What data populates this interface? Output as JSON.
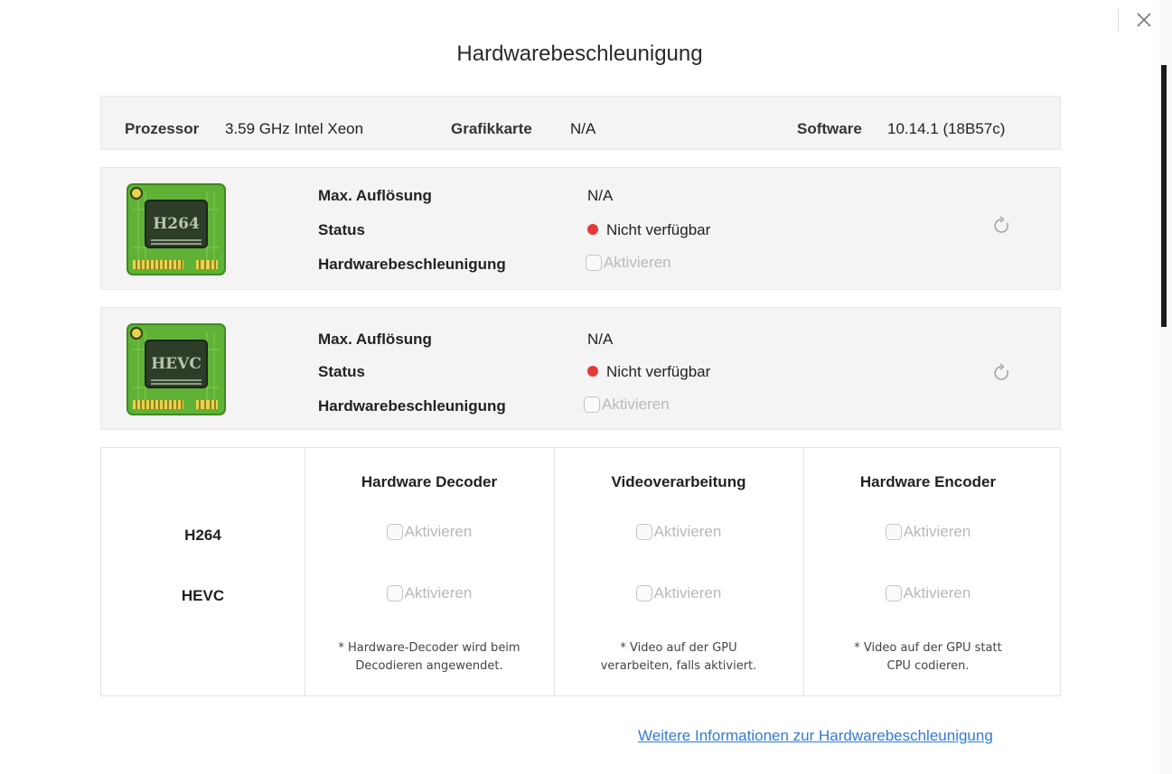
{
  "dialog": {
    "title": "Hardwarebeschleunigung",
    "close_icon": "close-icon"
  },
  "system": {
    "processor_label": "Prozessor",
    "processor_value": "3.59 GHz Intel Xeon",
    "gpu_label": "Grafikkarte",
    "gpu_value": "N/A",
    "software_label": "Software",
    "software_value": "10.14.1 (18B57c)"
  },
  "codecs": [
    {
      "chip_label": "H264",
      "max_res_label": "Max. Auflösung",
      "max_res_value": "N/A",
      "status_label": "Status",
      "status_value": "Nicht verfügbar",
      "status_color": "#e53939",
      "accel_label": "Hardwarebeschleunigung",
      "accel_checkbox": "Aktivieren",
      "refresh_icon": "refresh-icon"
    },
    {
      "chip_label": "HEVC",
      "max_res_label": "Max. Auflösung",
      "max_res_value": "N/A",
      "status_label": "Status",
      "status_value": "Nicht verfügbar",
      "status_color": "#e53939",
      "accel_label": "Hardwarebeschleunigung",
      "accel_checkbox": "Aktivieren",
      "refresh_icon": "refresh-icon"
    }
  ],
  "matrix": {
    "columns": [
      "Hardware Decoder",
      "Videoverarbeitung",
      "Hardware Encoder"
    ],
    "rows": [
      "H264",
      "HEVC"
    ],
    "checkbox_label": "Aktivieren",
    "notes": [
      [
        "* Hardware-Decoder wird beim",
        "Decodieren angewendet."
      ],
      [
        "* Video auf der GPU",
        "verarbeiten, falls aktiviert."
      ],
      [
        "* Video auf der GPU statt",
        "CPU codieren."
      ]
    ]
  },
  "footer": {
    "link": "Weitere Informationen zur Hardwarebeschleunigung",
    "link_color": "#2f7bd6"
  }
}
